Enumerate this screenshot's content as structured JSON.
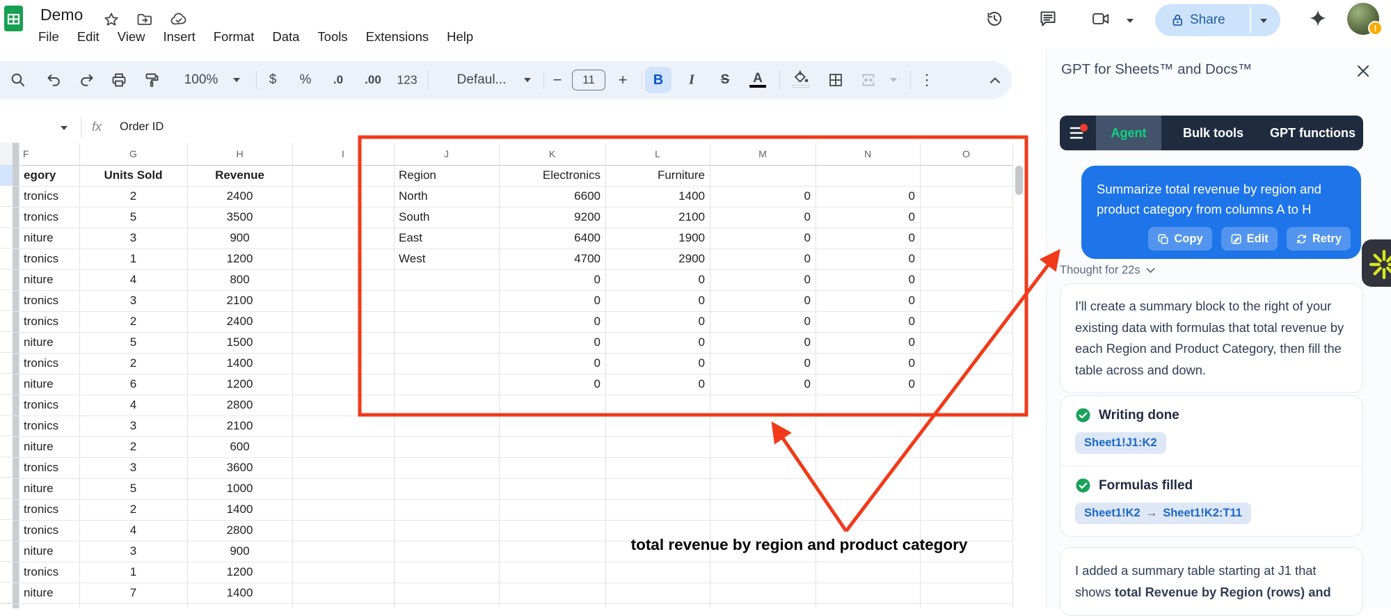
{
  "doc": {
    "title": "Demo"
  },
  "menubar": {
    "items": [
      "File",
      "Edit",
      "View",
      "Insert",
      "Format",
      "Data",
      "Tools",
      "Extensions",
      "Help"
    ]
  },
  "topbar": {
    "share_label": "Share"
  },
  "toolbar": {
    "zoom": "100%",
    "currency": "$",
    "percent": "%",
    "decrease_decimals": ".0",
    "increase_decimals": ".00",
    "more_formats": "123",
    "font_name": "Defaul...",
    "font_size": "11",
    "bold": "B",
    "italic": "I",
    "strikethrough": "S",
    "text_color": "A",
    "more": "⋮"
  },
  "formula_bar": {
    "fx": "fx",
    "value": "Order ID"
  },
  "sheet": {
    "columns": [
      "F",
      "G",
      "H",
      "I",
      "J",
      "K",
      "L",
      "M",
      "N",
      "O"
    ],
    "rows": [
      {
        "f": "egory",
        "g": "Units Sold",
        "h": "Revenue",
        "j": "Region",
        "k": "Electronics",
        "l": "Furniture",
        "m": "",
        "n": ""
      },
      {
        "f": "tronics",
        "g": "2",
        "h": "2400",
        "j": "North",
        "k": "6600",
        "l": "1400",
        "m": "0",
        "n": "0"
      },
      {
        "f": "tronics",
        "g": "5",
        "h": "3500",
        "j": "South",
        "k": "9200",
        "l": "2100",
        "m": "0",
        "n": "0"
      },
      {
        "f": "niture",
        "g": "3",
        "h": "900",
        "j": "East",
        "k": "6400",
        "l": "1900",
        "m": "0",
        "n": "0"
      },
      {
        "f": "tronics",
        "g": "1",
        "h": "1200",
        "j": "West",
        "k": "4700",
        "l": "2900",
        "m": "0",
        "n": "0"
      },
      {
        "f": "niture",
        "g": "4",
        "h": "800",
        "j": "",
        "k": "0",
        "l": "0",
        "m": "0",
        "n": "0"
      },
      {
        "f": "tronics",
        "g": "3",
        "h": "2100",
        "j": "",
        "k": "0",
        "l": "0",
        "m": "0",
        "n": "0"
      },
      {
        "f": "tronics",
        "g": "2",
        "h": "2400",
        "j": "",
        "k": "0",
        "l": "0",
        "m": "0",
        "n": "0"
      },
      {
        "f": "niture",
        "g": "5",
        "h": "1500",
        "j": "",
        "k": "0",
        "l": "0",
        "m": "0",
        "n": "0"
      },
      {
        "f": "tronics",
        "g": "2",
        "h": "1400",
        "j": "",
        "k": "0",
        "l": "0",
        "m": "0",
        "n": "0"
      },
      {
        "f": "niture",
        "g": "6",
        "h": "1200",
        "j": "",
        "k": "0",
        "l": "0",
        "m": "0",
        "n": "0"
      },
      {
        "f": "tronics",
        "g": "4",
        "h": "2800",
        "j": "",
        "k": "",
        "l": "",
        "m": "",
        "n": ""
      },
      {
        "f": "tronics",
        "g": "3",
        "h": "2100",
        "j": "",
        "k": "",
        "l": "",
        "m": "",
        "n": ""
      },
      {
        "f": "niture",
        "g": "2",
        "h": "600",
        "j": "",
        "k": "",
        "l": "",
        "m": "",
        "n": ""
      },
      {
        "f": "tronics",
        "g": "3",
        "h": "3600",
        "j": "",
        "k": "",
        "l": "",
        "m": "",
        "n": ""
      },
      {
        "f": "niture",
        "g": "5",
        "h": "1000",
        "j": "",
        "k": "",
        "l": "",
        "m": "",
        "n": ""
      },
      {
        "f": "tronics",
        "g": "2",
        "h": "1400",
        "j": "",
        "k": "",
        "l": "",
        "m": "",
        "n": ""
      },
      {
        "f": "tronics",
        "g": "4",
        "h": "2800",
        "j": "",
        "k": "",
        "l": "",
        "m": "",
        "n": ""
      },
      {
        "f": "niture",
        "g": "3",
        "h": "900",
        "j": "",
        "k": "",
        "l": "",
        "m": "",
        "n": ""
      },
      {
        "f": "tronics",
        "g": "1",
        "h": "1200",
        "j": "",
        "k": "",
        "l": "",
        "m": "",
        "n": ""
      },
      {
        "f": "niture",
        "g": "7",
        "h": "1400",
        "j": "",
        "k": "",
        "l": "",
        "m": "",
        "n": ""
      }
    ]
  },
  "annotation": {
    "label": "total revenue by region and product category"
  },
  "sidebar": {
    "title": "GPT for Sheets™ and Docs™",
    "tabs": {
      "agent": "Agent",
      "bulk": "Bulk tools",
      "functions": "GPT functions"
    },
    "prompt": {
      "text": "Summarize total revenue by region and product category from columns A to H",
      "copy": "Copy",
      "edit": "Edit",
      "retry": "Retry"
    },
    "thought": "Thought for 22s",
    "plan_message": "I'll create a summary block to the right of your existing data with formulas that total revenue by each Region and Product Category, then fill the table across and down.",
    "status1": {
      "label": "Writing done",
      "badge": "Sheet1!J1:K2"
    },
    "status2": {
      "label": "Formulas filled",
      "badge_from": "Sheet1!K2",
      "arrow": "→",
      "badge_to": "Sheet1!K2:T11"
    },
    "result_prefix": "I added a summary table starting at J1 that shows ",
    "result_bold": "total Revenue by Region (rows) and"
  },
  "colors": {
    "annotation_red": "#f2391a",
    "bubble_blue": "#1e74e9",
    "tab_green": "#0ed47e",
    "badge_text_blue": "#1b67ca",
    "check_green": "#19a15b",
    "share_bg": "#cde3fc",
    "toolbar_bg": "#edf2fa",
    "tabbar_navy": "#1f2c3f"
  }
}
